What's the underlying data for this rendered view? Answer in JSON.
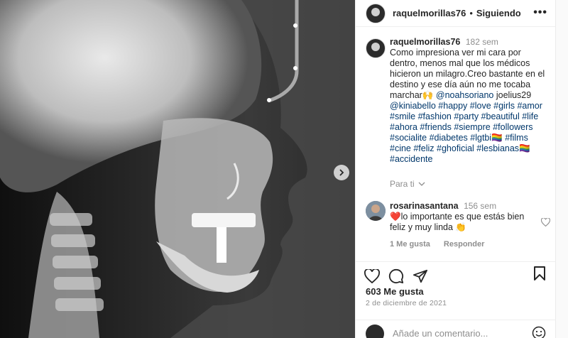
{
  "header": {
    "username": "raquelmorillas76",
    "separator": "•",
    "follow_label": "Siguiendo",
    "more_icon": "more-icon"
  },
  "caption": {
    "username": "raquelmorillas76",
    "time": "182 sem",
    "text": "Como impresiona ver mi cara por dentro, menos mal que los médicos hicieron un milagro.Creo bastante en el destino y ese día aún no me tocaba marchar🙌 ",
    "mention1": "@noahsoriano",
    "plain1": " joelius29 ",
    "mention2": "@kiniabello",
    "hashtags": "#happy #love #girls #amor #smile #fashion #party #beautiful #life #ahora #friends #siempre #followers #socialite #diabetes #lgtbi🏳️‍🌈 #films #cine #feliz #ghoficial #lesbianas🏳️‍🌈 #accidente"
  },
  "translate_label": "Para ti",
  "comment": {
    "username": "rosarinasantana",
    "time": "156 sem",
    "text": "❤️lo importante es que estás bien feliz y muy linda 👏",
    "likes": "1 Me gusta",
    "reply": "Responder"
  },
  "actions": {
    "likes": "603 Me gusta",
    "date": "2 de diciembre de 2021"
  },
  "add_comment": {
    "placeholder": "Añade un comentario..."
  },
  "colors": {
    "link": "#00376b",
    "muted": "#8e8e8e",
    "border": "#efefef"
  }
}
